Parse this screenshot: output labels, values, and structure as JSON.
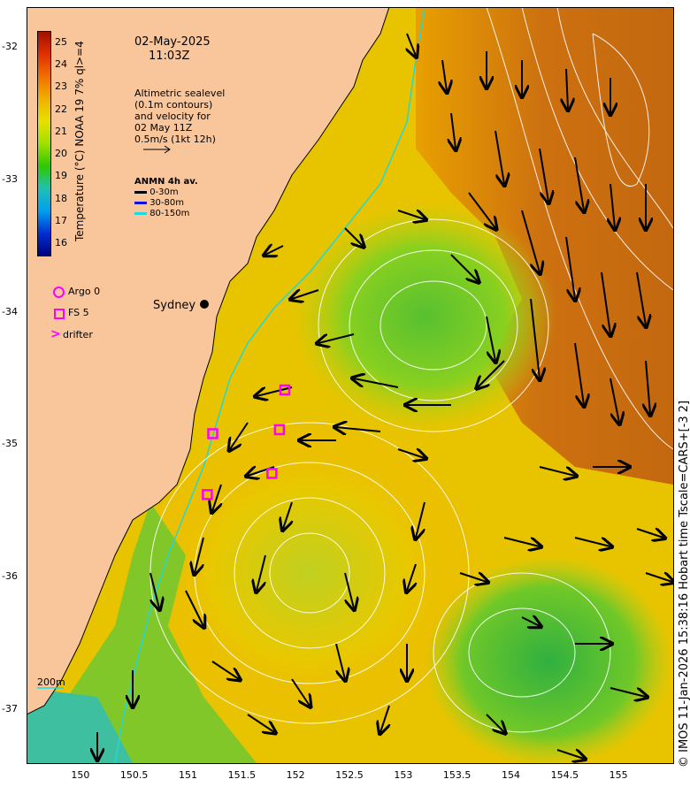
{
  "map": {
    "date": "02-May-2025",
    "time": "11:03Z",
    "altimetry_note": [
      "Altimetric sealevel",
      "(0.1m contours)",
      "and velocity for",
      "02 May 11Z",
      "0.5m/s (1kt 12h)"
    ],
    "anmn_title": "ANMN 4h av.",
    "anmn_items": [
      {
        "label": "0-30m",
        "color": "#000000"
      },
      {
        "label": "30-80m",
        "color": "#1010e0"
      },
      {
        "label": "80-150m",
        "color": "#20d8e0"
      }
    ],
    "city_label": "Sydney",
    "legend": {
      "argo": "Argo 0",
      "fs": "FS 5",
      "drifter": "drifter"
    },
    "scale_label": "200m",
    "credit": "© IMOS 11-Jan-2026 15:38:16 Hobart time Tscale=CARS+[-3 2]",
    "colorbar": {
      "label": "Temperature (°C) NOAA 19 7% ql>=4",
      "ticks": [
        "25",
        "24",
        "23",
        "22",
        "21",
        "20",
        "19",
        "18",
        "17",
        "16"
      ],
      "range": [
        15.5,
        25.5
      ]
    },
    "x_ticks": [
      "150",
      "150.5",
      "151",
      "151.5",
      "152",
      "152.5",
      "153",
      "153.5",
      "154",
      "154.5",
      "155"
    ],
    "y_ticks": [
      "-32",
      "-33",
      "-34",
      "-35",
      "-36",
      "-37"
    ],
    "lon_range": [
      149.5,
      155.5
    ],
    "lat_range": [
      -37.4,
      -31.7
    ],
    "colors": {
      "land": "#f9c69c",
      "warm": "#c6660a",
      "mid": "#f0b000",
      "cool": "#88d020",
      "coastal_water": "#40c0a0",
      "contour": "#ffffff",
      "isobath": "#20d8d8",
      "marker": "#ff00ff"
    },
    "fs_floats": [
      {
        "lon": 151.9,
        "lat": -34.59
      },
      {
        "lon": 151.23,
        "lat": -34.92
      },
      {
        "lon": 151.85,
        "lat": -34.89
      },
      {
        "lon": 151.78,
        "lat": -35.22
      },
      {
        "lon": 151.18,
        "lat": -35.38
      }
    ]
  }
}
